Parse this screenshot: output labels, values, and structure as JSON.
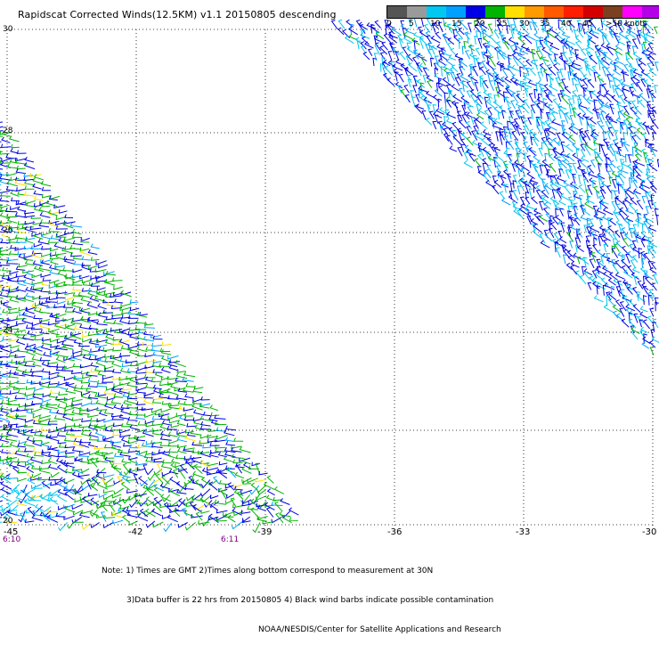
{
  "title": "Rapidscat Corrected Winds(12.5KM) v1.1 20150805 descending",
  "legend": {
    "colors": [
      "#555555",
      "#9a9a9a",
      "#00c8f0",
      "#00a0ff",
      "#0000e6",
      "#00b400",
      "#ffe000",
      "#ff9a00",
      "#ff5a00",
      "#ff1e00",
      "#d20000",
      "#7a4020",
      "#ff00ff",
      "#b400e6",
      "#6a0096"
    ],
    "labels": [
      "0",
      "5",
      "10",
      "15",
      "20",
      "25",
      "30",
      "35",
      "40",
      "45",
      ">50 knots"
    ]
  },
  "map": {
    "lon_labels": [
      "-45",
      "-42",
      "-39",
      "-36",
      "-33",
      "-30"
    ],
    "lat_labels": [
      "30",
      "28",
      "26",
      "24",
      "22",
      "20"
    ],
    "time_labels": [
      "6:10",
      "6:11"
    ]
  },
  "notes": [
    "Note: 1) Times are GMT 2)Times along bottom correspond to measurement at 30N",
    "3)Data buffer is 22 hrs from 20150805 4) Black wind barbs indicate possible contamination",
    "NOAA/NESDIS/Center for Satellite Applications and Research"
  ]
}
